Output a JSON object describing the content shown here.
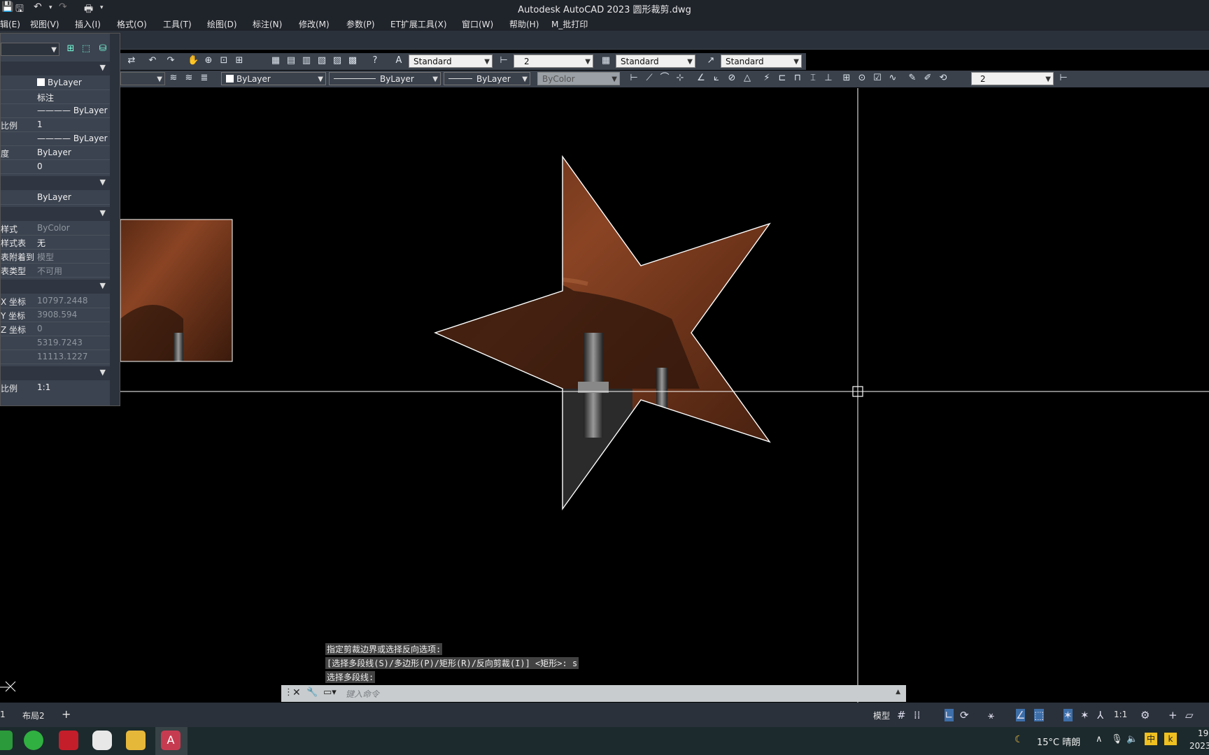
{
  "window": {
    "title": "Autodesk AutoCAD 2023    圆形裁剪.dwg"
  },
  "menu": {
    "items": [
      "辑(E)",
      "视图(V)",
      "插入(I)",
      "格式(O)",
      "工具(T)",
      "绘图(D)",
      "标注(N)",
      "修改(M)",
      "参数(P)",
      "ET扩展工具(X)",
      "窗口(W)",
      "帮助(H)",
      "M_批打印"
    ]
  },
  "toolbar": {
    "text_style": "Standard",
    "dim_scale": "2",
    "table_style": "Standard",
    "mleader_style": "Standard",
    "color": "ByLayer",
    "linetype": "ByLayer",
    "lineweight": "ByLayer",
    "plotstyle": "ByColor",
    "dim_value": "2"
  },
  "properties": {
    "rows": [
      {
        "label": "",
        "value": "ByLayer"
      },
      {
        "label": "",
        "value": "标注"
      },
      {
        "label": "",
        "value": "———— ByLayer"
      },
      {
        "label": "比例",
        "value": "1"
      },
      {
        "label": "",
        "value": "———— ByLayer"
      },
      {
        "label": "度",
        "value": "ByLayer"
      },
      {
        "label": "",
        "value": "0"
      }
    ],
    "section2": {
      "label": "",
      "value": "ByLayer"
    },
    "plot_rows": [
      {
        "label": "样式",
        "value": "ByColor"
      },
      {
        "label": "样式表",
        "value": "无"
      },
      {
        "label": "表附着到",
        "value": "模型"
      },
      {
        "label": "表类型",
        "value": "不可用"
      }
    ],
    "geo_rows": [
      {
        "label": "X 坐标",
        "value": "10797.2448"
      },
      {
        "label": "Y 坐标",
        "value": "3908.594"
      },
      {
        "label": "Z 坐标",
        "value": "0"
      },
      {
        "label": "",
        "value": "5319.7243"
      },
      {
        "label": "",
        "value": "11113.1227"
      }
    ],
    "last_row": {
      "label": "比例",
      "value": "1:1"
    }
  },
  "command": {
    "history": [
      "指定剪裁边界或选择反向选项:",
      "[选择多段线(S)/多边形(P)/矩形(R)/反向剪裁(I)] <矩形>: s",
      "选择多段线:"
    ],
    "placeholder": "键入命令"
  },
  "tabs": {
    "items": [
      "1",
      "布局2"
    ],
    "add": "+"
  },
  "status": {
    "model": "模型",
    "scale": "1:1"
  },
  "taskbar": {
    "weather": "15°C 晴朗",
    "time": "19",
    "date": "2023",
    "ime": "中"
  }
}
